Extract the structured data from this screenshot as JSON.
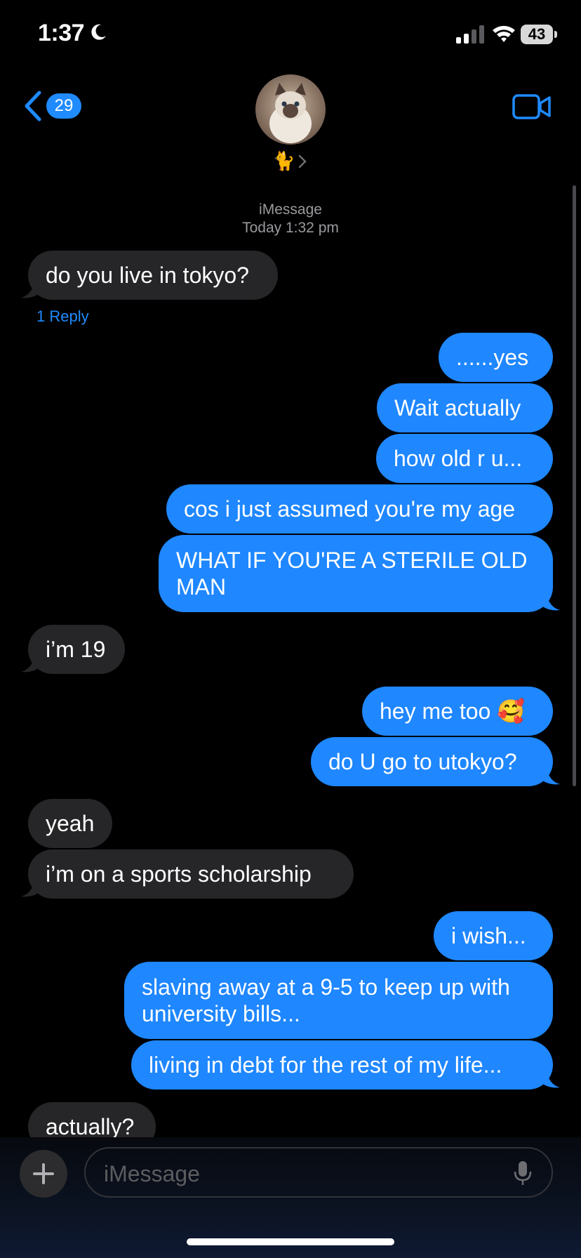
{
  "status_bar": {
    "time": "1:37",
    "battery": "43"
  },
  "header": {
    "back_badge": "29",
    "contact_name": "🐈"
  },
  "thread_meta": {
    "service": "iMessage",
    "timestamp": "Today 1:32 pm"
  },
  "messages": [
    {
      "direction": "in",
      "text": "do you live in tokyo?"
    },
    {
      "direction": "out",
      "text": "......yes"
    },
    {
      "direction": "out",
      "text": "Wait actually"
    },
    {
      "direction": "out",
      "text": "how old r u..."
    },
    {
      "direction": "out",
      "text": "cos i just assumed you're my age"
    },
    {
      "direction": "out",
      "text": "WHAT IF YOU'RE A STERILE OLD MAN"
    },
    {
      "direction": "in",
      "text": "i’m 19"
    },
    {
      "direction": "out",
      "text": "hey me too 🥰"
    },
    {
      "direction": "out",
      "text": "do U go to utokyo?"
    },
    {
      "direction": "in",
      "text": "yeah"
    },
    {
      "direction": "in",
      "text": "i’m on a sports scholarship"
    },
    {
      "direction": "out",
      "text": "i wish..."
    },
    {
      "direction": "out",
      "text": "slaving away at a 9-5 to keep up with university bills..."
    },
    {
      "direction": "out",
      "text": "living in debt for the rest of my life..."
    },
    {
      "direction": "in",
      "text": "actually?"
    }
  ],
  "reply_link": "1 Reply",
  "composer": {
    "placeholder": "iMessage"
  },
  "colors": {
    "outgoing": "#1f87ff",
    "incoming": "#262628",
    "accent": "#1f8bff"
  }
}
